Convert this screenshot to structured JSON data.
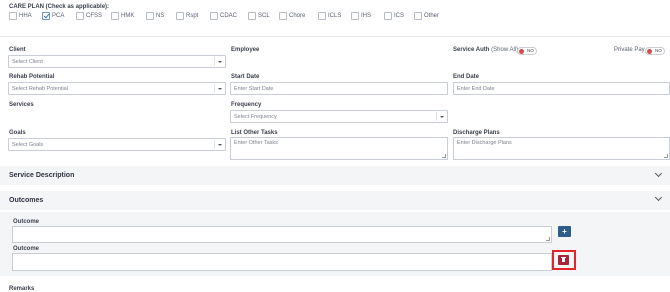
{
  "care_plan": {
    "title": "CARE PLAN (Check as applicable):",
    "options": [
      {
        "label": "HHA",
        "checked": false
      },
      {
        "label": "PCA",
        "checked": true
      },
      {
        "label": "CFSS",
        "checked": false
      },
      {
        "label": "HMK",
        "checked": false
      },
      {
        "label": "NS",
        "checked": false
      },
      {
        "label": "Rspt",
        "checked": false
      },
      {
        "label": "CDAC",
        "checked": false
      },
      {
        "label": "SCL",
        "checked": false
      },
      {
        "label": "Chore",
        "checked": false
      },
      {
        "label": "ICLS",
        "checked": false
      },
      {
        "label": "IHS",
        "checked": false
      },
      {
        "label": "ICS",
        "checked": false
      },
      {
        "label": "Other",
        "checked": false
      }
    ]
  },
  "form": {
    "client_label": "Client",
    "client_placeholder": "Select Client",
    "employee_label": "Employee",
    "service_auth_label": "Service Auth",
    "service_auth_sub": "(Show All)",
    "service_auth_toggle": "NO",
    "private_pay_label": "Private Pay",
    "private_pay_toggle": "NO",
    "rehab_label": "Rehab Potential",
    "rehab_placeholder": "Select Rehab Potential",
    "start_label": "Start Date",
    "start_placeholder": "Enter Start Date",
    "end_label": "End Date",
    "end_placeholder": "Enter End Date",
    "services_label": "Services",
    "frequency_label": "Frequency",
    "frequency_placeholder": "Select Frequency",
    "goals_label": "Goals",
    "goals_placeholder": "Select Goals",
    "tasks_label": "List Other Tasks",
    "tasks_placeholder": "Enter Other Tasks",
    "discharge_label": "Discharge Plans",
    "discharge_placeholder": "Enter Discharge Plans"
  },
  "sections": {
    "service_description": "Service Description",
    "outcomes": "Outcomes",
    "outcome_label_1": "Outcome",
    "outcome_label_2": "Outcome",
    "remarks": "Remarks"
  },
  "icons": {
    "add": "+",
    "delete": "trash-icon",
    "collapse": "chevron-down-icon"
  },
  "colors": {
    "add_button": "#2f5d8a",
    "delete_button": "#a8243a",
    "highlight": "#e0252b",
    "toggle_off": "#d64a4a"
  }
}
